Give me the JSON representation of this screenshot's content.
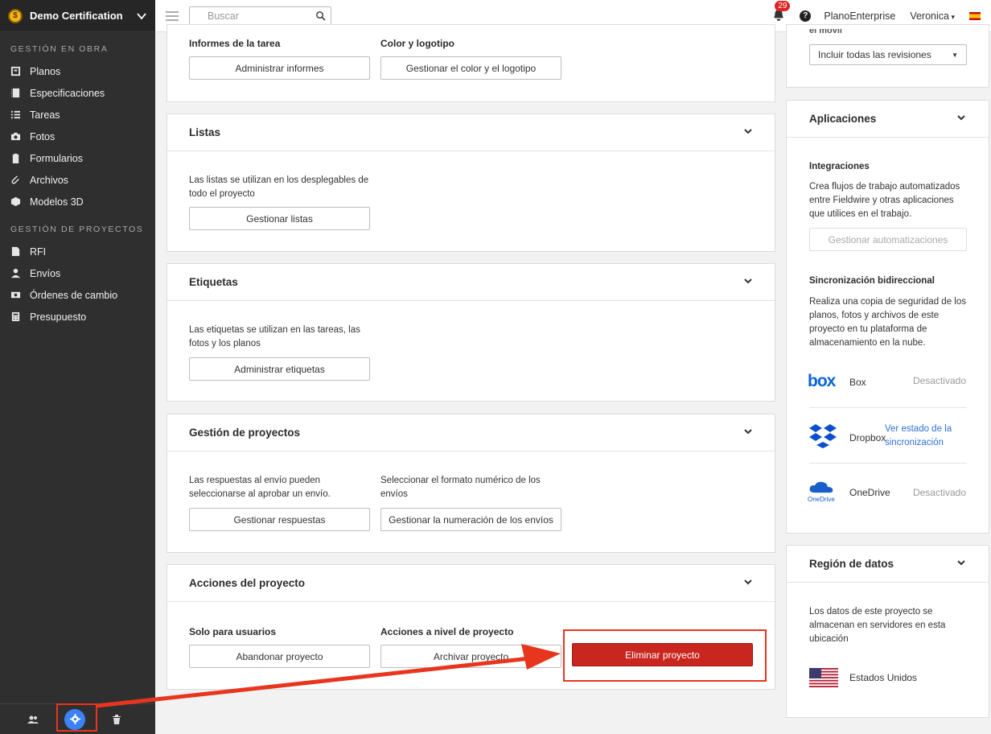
{
  "sidebar": {
    "project_name": "Demo Certification",
    "sections": [
      {
        "label": "GESTIÓN EN OBRA",
        "items": [
          {
            "label": "Planos",
            "icon": "plans-icon"
          },
          {
            "label": "Especificaciones",
            "icon": "specs-icon"
          },
          {
            "label": "Tareas",
            "icon": "tasks-icon"
          },
          {
            "label": "Fotos",
            "icon": "camera-icon"
          },
          {
            "label": "Formularios",
            "icon": "clipboard-icon"
          },
          {
            "label": "Archivos",
            "icon": "paperclip-icon"
          },
          {
            "label": "Modelos 3D",
            "icon": "cube-icon"
          }
        ]
      },
      {
        "label": "GESTIÓN DE PROYECTOS",
        "items": [
          {
            "label": "RFI",
            "icon": "rfi-icon"
          },
          {
            "label": "Envíos",
            "icon": "person-icon"
          },
          {
            "label": "Órdenes de cambio",
            "icon": "money-icon"
          },
          {
            "label": "Presupuesto",
            "icon": "calculator-icon"
          }
        ]
      }
    ],
    "bottom_icons": [
      "users-icon",
      "gear-icon",
      "trash-icon"
    ]
  },
  "topbar": {
    "search_placeholder": "Buscar",
    "notifications_count": "29",
    "help_label": "?",
    "plan": "PlanoEnterprise",
    "user": "Veronica"
  },
  "main": {
    "reports_section": {
      "col1_label": "Informes de la tarea",
      "col1_button": "Administrar informes",
      "col2_label": "Color y logotipo",
      "col2_button": "Gestionar el color y el logotipo"
    },
    "lists": {
      "title": "Listas",
      "description": "Las listas se utilizan en los desplegables de todo el proyecto",
      "button": "Gestionar listas"
    },
    "tags": {
      "title": "Etiquetas",
      "description": "Las etiquetas se utilizan en las tareas, las fotos y los planos",
      "button": "Administrar etiquetas"
    },
    "project_management": {
      "title": "Gestión de proyectos",
      "col1_description": "Las respuestas al envío pueden seleccionarse al aprobar un envío.",
      "col1_button": "Gestionar respuestas",
      "col2_description": "Seleccionar el formato numérico de los envíos",
      "col2_button": "Gestionar la numeración de los envíos"
    },
    "project_actions": {
      "title": "Acciones del proyecto",
      "col1_label": "Solo para usuarios",
      "col1_button": "Abandonar proyecto",
      "col2_label": "Acciones a nivel de proyecto",
      "col2_button": "Archivar proyecto",
      "delete_button": "Eliminar proyecto"
    }
  },
  "right": {
    "mobile": {
      "partial_label": "el móvil",
      "select_value": "Incluir todas las revisiones"
    },
    "apps": {
      "title": "Aplicaciones",
      "integrations_label": "Integraciones",
      "integrations_description": "Crea flujos de trabajo automatizados entre Fieldwire y otras aplicaciones que utilices en el trabajo.",
      "automations_button": "Gestionar automatizaciones",
      "sync_label": "Sincronización bidireccional",
      "sync_description": "Realiza una copia de seguridad de los planos, fotos y archivos de este proyecto en tu plataforma de almacenamiento en la nube.",
      "providers": [
        {
          "name": "Box",
          "status": "Desactivado",
          "logo": "box"
        },
        {
          "name": "Dropbox",
          "status": "Ver estado de la sincronización",
          "logo": "dropbox"
        },
        {
          "name": "OneDrive",
          "status": "Desactivado",
          "logo": "OneDrive"
        }
      ]
    },
    "data_region": {
      "title": "Región de datos",
      "description": "Los datos de este proyecto se almacenan en servidores en esta ubicación",
      "region": "Estados Unidos"
    }
  },
  "colors": {
    "danger": "#c8261f",
    "highlight": "#e8351e",
    "accent_blue": "#3b82f6",
    "sidebar_bg": "#2f2f2f"
  }
}
